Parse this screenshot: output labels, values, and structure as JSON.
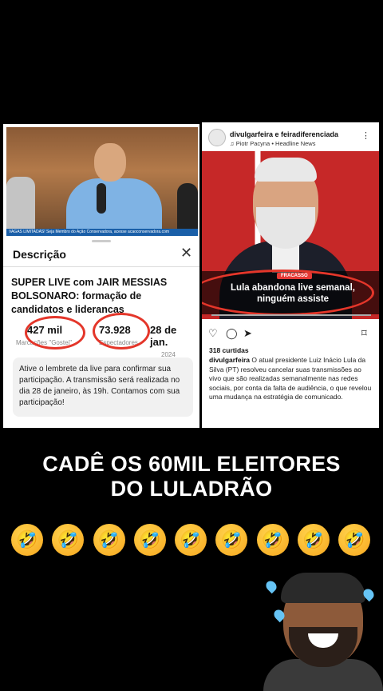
{
  "youtube": {
    "ticker": "VAGAS LIMITADAS! Seja Membro do Ação Conservadora, acesse acaoconservadora.com",
    "description_title": "Descrição",
    "close_glyph": "✕",
    "video_title": "SUPER LIVE com JAIR MESSIAS BOLSONARO: formação de candidatos e lideranças",
    "stats": [
      {
        "value": "427 mil",
        "label": "Marcações \"Gostei\""
      },
      {
        "value": "73.928",
        "label": "Espectadores"
      },
      {
        "value": "28 de jan.",
        "label": "2024"
      }
    ],
    "reminder": "Ative o lembrete da live para confirmar sua participação. A transmissão será realizada no dia 28 de janeiro, às 19h. Contamos com sua participação!"
  },
  "instagram": {
    "username": "divulgarfeira e feiradiferenciada",
    "music": "♫ Piotr Pacyna • Headline News",
    "more_glyph": "⋮",
    "badge": "FRACASSO",
    "headline": "Lula abandona live semanal, ninguém assiste",
    "likes": "318 curtidas",
    "caption_user": "divulgarfeira",
    "caption_text": "O atual presidente Luiz Inácio Lula da Silva (PT) resolveu cancelar suas transmissões ao vivo que são realizadas semanalmente nas redes sociais, por conta da falta de audiência, o que revelou uma mudança na estratégia de comunicado."
  },
  "overlay": {
    "line1": "CADÊ OS 60MIL ELEITORES",
    "line2": "DO LULADRÃO"
  },
  "emojis": [
    "🤣",
    "🤣",
    "🤣",
    "🤣",
    "🤣",
    "🤣",
    "🤣",
    "🤣",
    "🤣"
  ],
  "colors": {
    "annotation_red": "#e4362a",
    "ticker_blue": "#1a5fa8",
    "badge_red": "#e53935"
  }
}
